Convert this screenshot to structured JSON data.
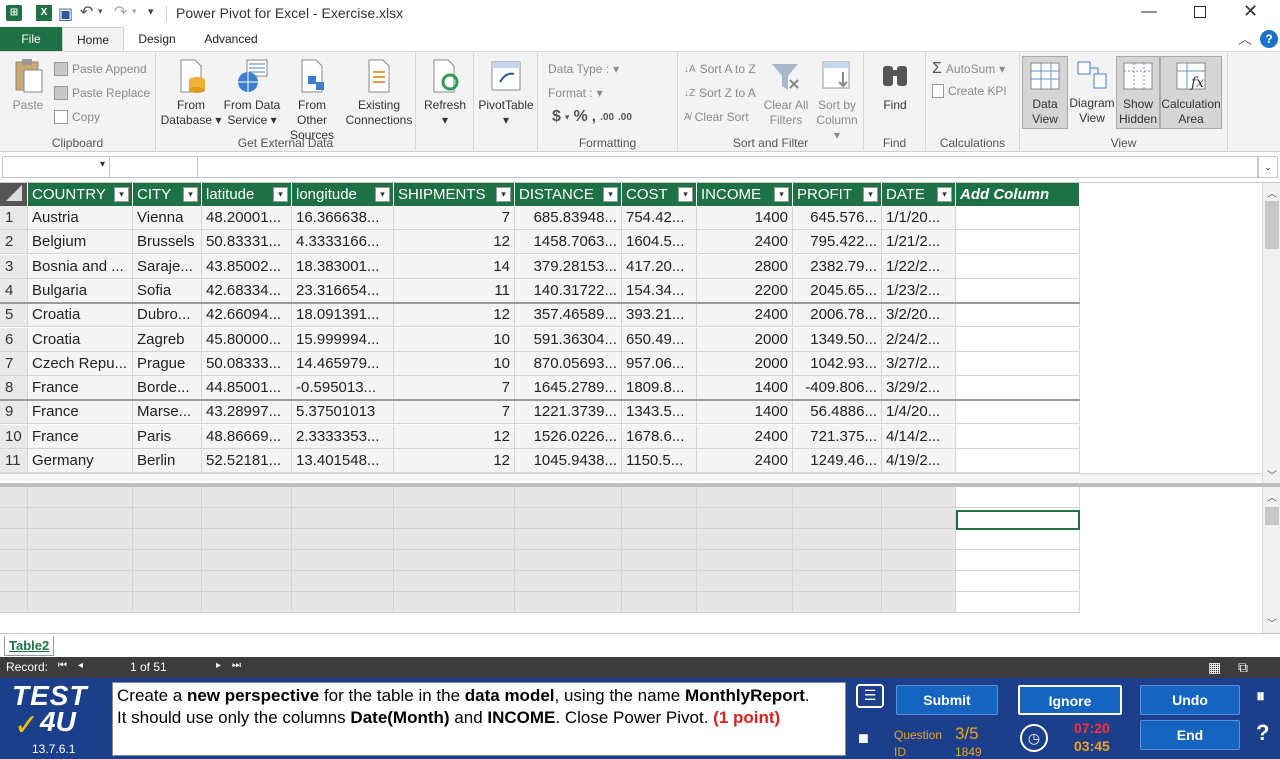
{
  "titlebar": {
    "title": "Power Pivot for Excel - Exercise.xlsx",
    "qat_more": "▾"
  },
  "tabs": [
    {
      "label": "File"
    },
    {
      "label": "Home"
    },
    {
      "label": "Design"
    },
    {
      "label": "Advanced"
    }
  ],
  "ribbon": {
    "clipboard": {
      "paste": "Paste",
      "paste_append": "Paste Append",
      "paste_replace": "Paste Replace",
      "copy": "Copy",
      "group": "Clipboard"
    },
    "external": {
      "from_database_1": "From",
      "from_database_2": "Database",
      "from_data_service_1": "From Data",
      "from_data_service_2": "Service",
      "from_other_1": "From Other",
      "from_other_2": "Sources",
      "existing_1": "Existing",
      "existing_2": "Connections",
      "group": "Get External Data"
    },
    "refresh": "Refresh",
    "pivottable": "PivotTable",
    "formatting": {
      "data_type": "Data Type :",
      "format": "Format :",
      "currency": "$",
      "percent": "%",
      "comma": "̧",
      "inc": ".00",
      "dec": ".00",
      "group": "Formatting"
    },
    "sort": {
      "sort_az": "Sort A to Z",
      "sort_za": "Sort Z to A",
      "clear_sort": "Clear Sort",
      "clear_filters_1": "Clear All",
      "clear_filters_2": "Filters",
      "sort_by_1": "Sort by",
      "sort_by_2": "Column",
      "group": "Sort and Filter"
    },
    "find": {
      "label": "Find",
      "group": "Find"
    },
    "calculations": {
      "autosum": "AutoSum",
      "create_kpi": "Create KPI",
      "group": "Calculations"
    },
    "view": {
      "data_view_1": "Data",
      "data_view_2": "View",
      "diagram_view_1": "Diagram",
      "diagram_view_2": "View",
      "show_hidden_1": "Show",
      "show_hidden_2": "Hidden",
      "calc_area_1": "Calculation",
      "calc_area_2": "Area",
      "group": "View"
    }
  },
  "table": {
    "columns": [
      "COUNTRY",
      "CITY",
      "latitude",
      "longitude",
      "SHIPMENTS",
      "DISTANCE",
      "COST",
      "INCOME",
      "PROFIT",
      "DATE"
    ],
    "add_column": "Add Column",
    "rows": [
      [
        "1",
        "Austria",
        "Vienna",
        "48.20001...",
        "16.366638...",
        "7",
        "685.83948...",
        "754.42...",
        "1400",
        "645.576...",
        "1/1/20..."
      ],
      [
        "2",
        "Belgium",
        "Brussels",
        "50.83331...",
        "4.3333166...",
        "12",
        "1458.7063...",
        "1604.5...",
        "2400",
        "795.422...",
        "1/21/2..."
      ],
      [
        "3",
        "Bosnia and ...",
        "Saraje...",
        "43.85002...",
        "18.383001...",
        "14",
        "379.28153...",
        "417.20...",
        "2800",
        "2382.79...",
        "1/22/2..."
      ],
      [
        "4",
        "Bulgaria",
        "Sofia",
        "42.68334...",
        "23.316654...",
        "11",
        "140.31722...",
        "154.34...",
        "2200",
        "2045.65...",
        "1/23/2..."
      ],
      [
        "5",
        "Croatia",
        "Dubro...",
        "42.66094...",
        "18.091391...",
        "12",
        "357.46589...",
        "393.21...",
        "2400",
        "2006.78...",
        "3/2/20..."
      ],
      [
        "6",
        "Croatia",
        "Zagreb",
        "45.80000...",
        "15.999994...",
        "10",
        "591.36304...",
        "650.49...",
        "2000",
        "1349.50...",
        "2/24/2..."
      ],
      [
        "7",
        "Czech Repu...",
        "Prague",
        "50.08333...",
        "14.465979...",
        "10",
        "870.05693...",
        "957.06...",
        "2000",
        "1042.93...",
        "3/27/2..."
      ],
      [
        "8",
        "France",
        "Borde...",
        "44.85001...",
        "-0.595013...",
        "7",
        "1645.2789...",
        "1809.8...",
        "1400",
        "-409.806...",
        "3/29/2..."
      ],
      [
        "9",
        "France",
        "Marse...",
        "43.28997...",
        "5.37501013",
        "7",
        "1221.3739...",
        "1343.5...",
        "1400",
        "56.4886...",
        "1/4/20..."
      ],
      [
        "10",
        "France",
        "Paris",
        "48.86669...",
        "2.3333353...",
        "12",
        "1526.0226...",
        "1678.6...",
        "2400",
        "721.375...",
        "4/14/2..."
      ],
      [
        "11",
        "Germany",
        "Berlin",
        "52.52181...",
        "13.401548...",
        "12",
        "1045.9438...",
        "1150.5...",
        "2400",
        "1249.46...",
        "4/19/2..."
      ]
    ]
  },
  "sheet_tab": "Table2",
  "record": {
    "label": "Record:",
    "position": "1 of 51"
  },
  "test": {
    "logo_top": "TEST",
    "logo_bottom": "4U",
    "version": "13.7.6.1",
    "question_label": "Question",
    "question_value": "3/5",
    "id_label": "ID",
    "id_value": "1849",
    "time_1": "07:20",
    "time_2": "03:45",
    "submit": "Submit",
    "ignore": "Ignore",
    "undo": "Undo",
    "end": "End"
  },
  "colors": {
    "accent_green": "#1e7145",
    "test_blue": "#1b3f8a",
    "point_red": "#e02020"
  }
}
